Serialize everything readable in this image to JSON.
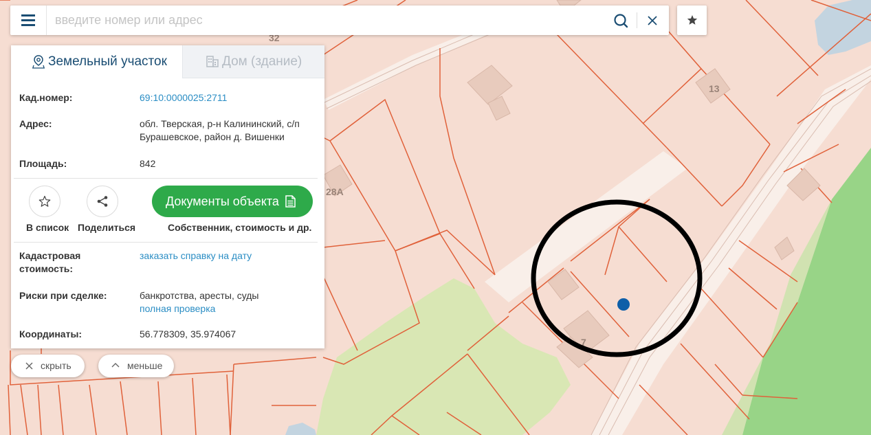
{
  "search": {
    "placeholder": "введите номер или адрес"
  },
  "icons": {
    "menu": "menu-icon",
    "search": "search-icon",
    "clear": "close-icon",
    "favorite": "star-icon",
    "land_tab": "map-pin-icon",
    "house_tab": "building-icon",
    "add_to_list": "star-outline-icon",
    "share": "share-icon",
    "documents": "document-icon",
    "hide": "close-icon",
    "less": "chevron-up-icon"
  },
  "colors": {
    "accent": "#1a4d73",
    "link": "#2a8dc4",
    "primary_button": "#2eaa4a",
    "marker": "#0e5fa8",
    "parcel_border": "#e0613a"
  },
  "tabs": {
    "land": "Земельный участок",
    "house": "Дом (здание)"
  },
  "info": {
    "cad_label": "Кад.номер:",
    "cad_value": "69:10:0000025:2711",
    "address_label": "Адрес:",
    "address_line1": "обл. Тверская, р-н Калининский, с/п",
    "address_line2": "Бурашевское, район д. Вишенки",
    "area_label": "Площадь:",
    "area_value": "842",
    "cost_label_line1": "Кадастровая",
    "cost_label_line2": "стоимость:",
    "cost_link": "заказать справку на дату",
    "risk_label": "Риски при сделке:",
    "risk_value": "банкротства, аресты, суды",
    "risk_link": "полная проверка",
    "coords_label": "Координаты:",
    "coords_value": "56.778309, 35.974067"
  },
  "actions": {
    "add_to_list": "В список",
    "share": "Поделиться",
    "documents_button": "Документы объекта",
    "documents_sub": "Собственник, стоимость и др."
  },
  "controls": {
    "hide": "скрыть",
    "less": "меньше"
  },
  "map": {
    "labels": [
      "32",
      "13",
      "28А",
      "7"
    ]
  }
}
